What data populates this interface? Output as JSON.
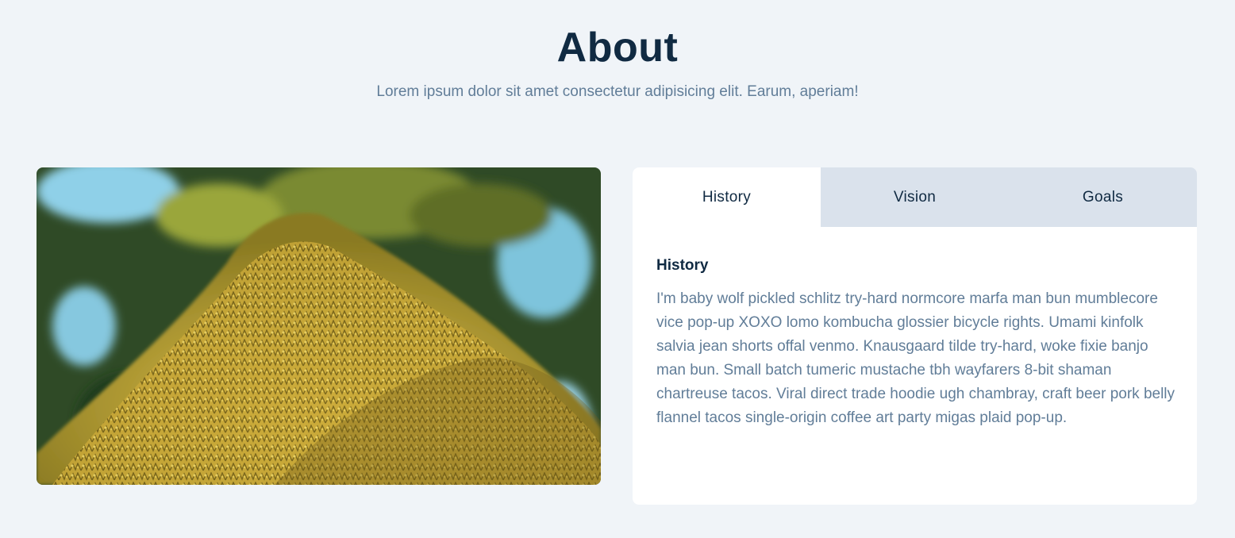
{
  "section": {
    "title": "About",
    "subtitle": "Lorem ipsum dolor sit amet consectetur adipisicing elit. Earum, aperiam!"
  },
  "image": {
    "icon": "moss-tree-photo",
    "colors": {
      "sky": "#8fd0e8",
      "foliage": "#3f5a2a",
      "moss": "#c4a53a",
      "moss_dark": "#7a6a1c"
    }
  },
  "tabs": [
    {
      "label": "History",
      "active": true
    },
    {
      "label": "Vision",
      "active": false
    },
    {
      "label": "Goals",
      "active": false
    }
  ],
  "content": {
    "title": "History",
    "text": "I'm baby wolf pickled schlitz try-hard normcore marfa man bun mumblecore vice pop-up XOXO lomo kombucha glossier bicycle rights. Umami kinfolk salvia jean shorts offal venmo. Knausgaard tilde try-hard, woke fixie banjo man bun. Small batch tumeric mustache tbh wayfarers 8-bit shaman chartreuse tacos. Viral direct trade hoodie ugh chambray, craft beer pork belly flannel tacos single-origin coffee art party migas plaid pop-up."
  },
  "colors": {
    "background": "#f0f4f8",
    "title": "#102a42",
    "muted_text": "#617d98",
    "tab_inactive": "#dae2ec",
    "card": "#ffffff"
  }
}
